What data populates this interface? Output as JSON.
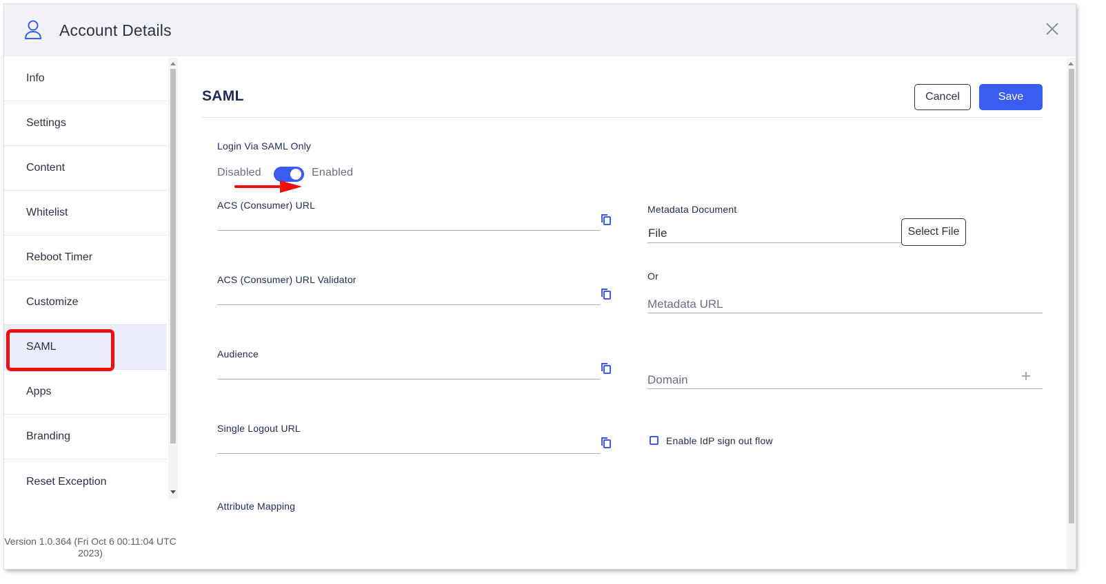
{
  "header": {
    "title": "Account Details"
  },
  "sidebar": {
    "items": [
      {
        "label": "Info"
      },
      {
        "label": "Settings"
      },
      {
        "label": "Content"
      },
      {
        "label": "Whitelist"
      },
      {
        "label": "Reboot Timer"
      },
      {
        "label": "Customize"
      },
      {
        "label": "SAML"
      },
      {
        "label": "Apps"
      },
      {
        "label": "Branding"
      },
      {
        "label": "Reset Exception"
      }
    ],
    "active_item": "SAML",
    "version_line1": "Version 1.0.364 (Fri Oct 6 00:11:04 UTC",
    "version_line2": "2023)"
  },
  "main": {
    "section_title": "SAML",
    "cancel_label": "Cancel",
    "save_label": "Save",
    "login_saml": {
      "label": "Login Via SAML Only",
      "off_label": "Disabled",
      "on_label": "Enabled",
      "enabled": true
    },
    "fields": {
      "acs_url": {
        "label": "ACS (Consumer) URL",
        "value": ""
      },
      "acs_validator": {
        "label": "ACS (Consumer) URL Validator",
        "value": ""
      },
      "audience": {
        "label": "Audience",
        "value": ""
      },
      "single_logout": {
        "label": "Single Logout URL",
        "value": ""
      },
      "attribute_mapping": {
        "label": "Attribute Mapping"
      }
    },
    "metadata": {
      "label": "Metadata Document",
      "file_value": "File",
      "select_file_label": "Select File",
      "or_label": "Or",
      "url_placeholder": "Metadata URL",
      "domain_placeholder": "Domain",
      "idp_signout_label": "Enable IdP sign out flow",
      "idp_signout_checked": false
    }
  },
  "colors": {
    "accent": "#3b5cf2",
    "highlight": "#f20d0d",
    "active_bg": "#e8ecfb"
  }
}
